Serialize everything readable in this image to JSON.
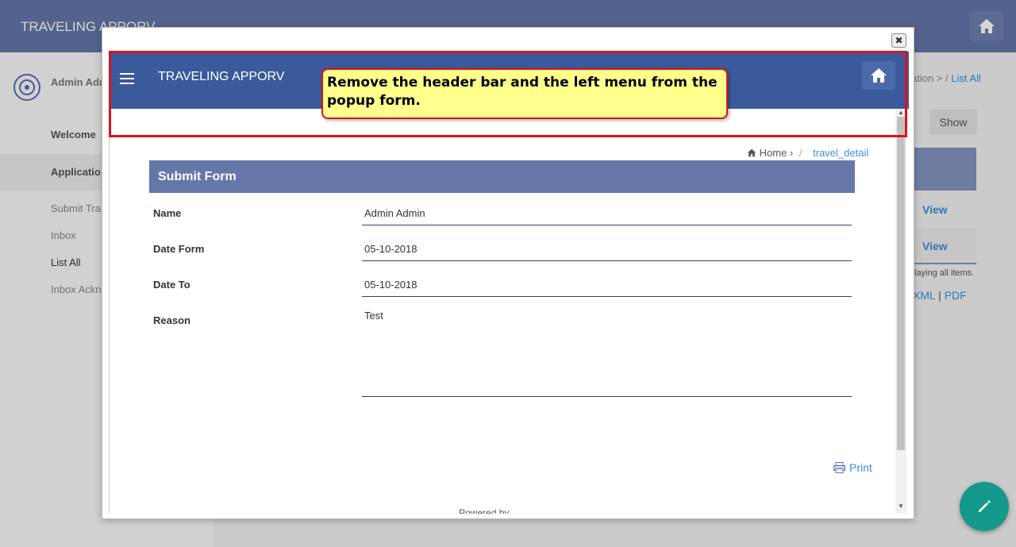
{
  "app": {
    "title": "TRAVELING APPORV"
  },
  "sidebar": {
    "user_name": "Admin Adm",
    "welcome": "Welcome",
    "application": "Applicatio",
    "items": [
      "Submit Tra",
      "Inbox",
      "List All",
      "Inbox Ackn"
    ]
  },
  "background": {
    "breadcrumb_prev": "ation >",
    "breadcrumb_sep": "/",
    "breadcrumb_current": "List All",
    "show_button": "Show",
    "view_link_1": "View",
    "view_link_2": "View",
    "display_info": "laying all items.",
    "export_xml": "XML",
    "export_sep": "|",
    "export_pdf": "PDF"
  },
  "popup": {
    "close_label": "✖",
    "header_title": "TRAVELING APPORV",
    "breadcrumb_home": "Home",
    "breadcrumb_sep": "/",
    "breadcrumb_current": "travel_detail",
    "form_title": "Submit Form",
    "fields": [
      {
        "label": "Name",
        "value": "Admin Admin"
      },
      {
        "label": "Date Form",
        "value": "05-10-2018"
      },
      {
        "label": "Date To",
        "value": "05-10-2018"
      },
      {
        "label": "Reason",
        "value": "Test"
      }
    ],
    "print_label": "Print",
    "bottom_text": "Powered by ..."
  },
  "annotation": {
    "callout_text": "Remove the header bar and the left menu from the popup form.",
    "highlight_color": "#d9141c",
    "callout_bg": "#ffff8c"
  },
  "colors": {
    "header_blue": "#3a5a9c",
    "form_header": "#6577a8",
    "link_blue": "#3a8fd8",
    "fab_teal": "#15998a"
  }
}
